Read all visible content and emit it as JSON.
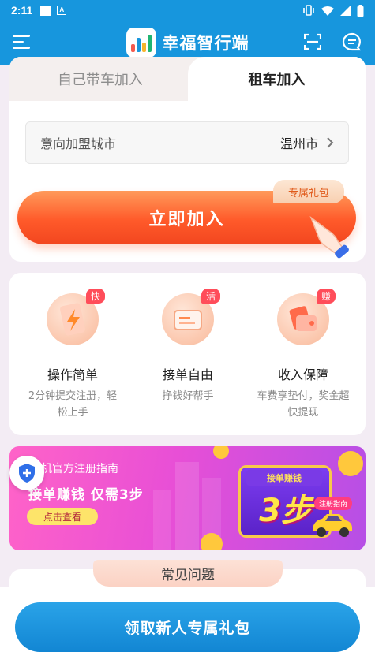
{
  "status_bar": {
    "time": "2:11",
    "icons": [
      "sim-icon",
      "a-icon",
      "vibrate-icon",
      "wifi-icon",
      "signal-icon",
      "battery-icon"
    ]
  },
  "header": {
    "title": "幸福智行端",
    "icons": [
      "menu-icon",
      "scan-icon",
      "chat-icon"
    ]
  },
  "tabs": {
    "self_car": "自己带车加入",
    "rent_car": "租车加入",
    "active": "rent_car"
  },
  "city": {
    "label": "意向加盟城市",
    "value": "温州市"
  },
  "join": {
    "label": "立即加入",
    "badge": "专属礼包"
  },
  "features": [
    {
      "tag": "快",
      "title": "操作简单",
      "desc": "2分钟提交注册，轻松上手"
    },
    {
      "tag": "活",
      "title": "接单自由",
      "desc": "挣钱好帮手"
    },
    {
      "tag": "赚",
      "title": "收入保障",
      "desc": "车费享垫付，奖金超快提现"
    }
  ],
  "banner": {
    "title": "机官方注册指南",
    "subtitle": "接单赚钱 仅需3步",
    "button": "点击查看",
    "steps_head": "接单赚钱",
    "steps_num": "3步",
    "guide_tag": "注册指南"
  },
  "faq": {
    "title": "常见问题"
  },
  "bottom": {
    "button": "领取新人专属礼包"
  },
  "colors": {
    "primary": "#1796dd",
    "accent": "#ff5a2a",
    "banner": "#e84fd6"
  }
}
